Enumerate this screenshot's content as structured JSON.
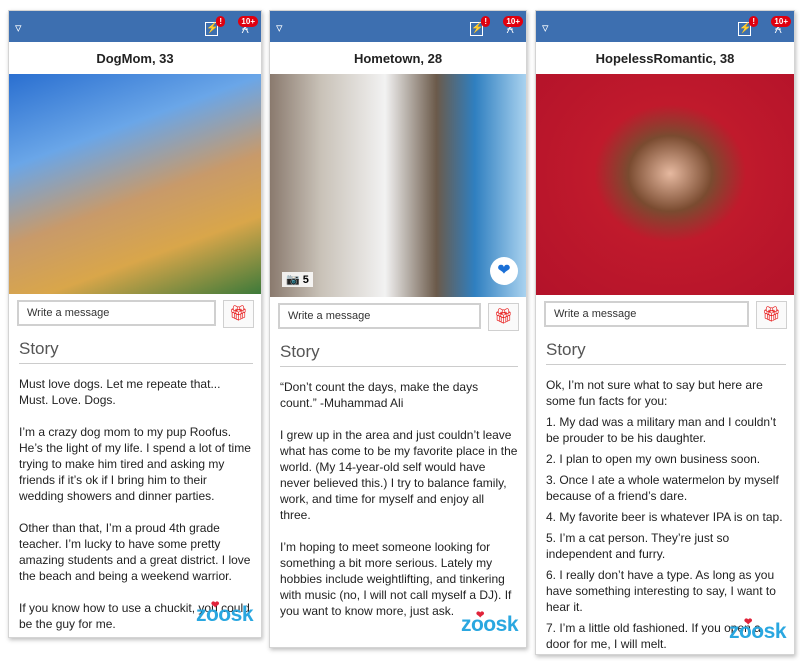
{
  "header": {
    "notification_badge": "!",
    "bell_badge": "10+",
    "filter_icon": "filter-icon",
    "boost_icon": "lightning-icon",
    "bell_icon": "bell-icon",
    "color": "#3d6fb0"
  },
  "common": {
    "message_placeholder": "Write a message",
    "story_heading": "Story",
    "logo": "zoosk",
    "gift_icon": "gift-icon"
  },
  "profiles": [
    {
      "name": "DogMom, 33",
      "paragraphs": [
        "Must love dogs. Let me repeate that... Must. Love. Dogs.",
        "I’m a crazy dog mom to my pup Roofus. He’s the light of my life. I spend a lot of time trying to make him tired and asking my friends if it’s ok if I bring him to their wedding showers and dinner parties.",
        "Other than that, I’m a proud 4th grade teacher. I’m lucky to have some pretty amazing students and a great district. I love the beach and being a weekend warrior.",
        "If you know how to use a chuckit, you could be the guy for me."
      ]
    },
    {
      "name": "Hometown, 28",
      "photo_count": "5",
      "paragraphs": [
        "“Don’t count the days, make the days count.” -Muhammad Ali",
        "I grew up in the area and just couldn’t leave what has come to be my favorite place in the world. (My 14-year-old self would have never believed this.) I try to balance family, work, and time for myself and enjoy all three.",
        "I’m hoping to meet someone looking for something a bit more serious. Lately my hobbies include weightlifting, and tinkering with music (no, I will not call myself a DJ). If you want to know more, just ask."
      ]
    },
    {
      "name": "HopelessRomantic, 38",
      "paragraphs": [
        "Ok, I’m not sure what to say but here are some fun facts for you:",
        "1. My dad was a military man and I couldn’t be prouder to be his daughter.",
        "2. I plan to open my own business soon.",
        "3. Once I ate a whole watermelon by myself because of a friend’s dare.",
        "4. My favorite beer is whatever IPA is on tap.",
        "5. I’m a cat person. They’re just so independent and furry.",
        "6. I really don’t have a type. As long as you have something interesting to say, I want to hear it.",
        "7. I’m a little old fashioned. If you open a door for me, I will melt."
      ]
    }
  ]
}
